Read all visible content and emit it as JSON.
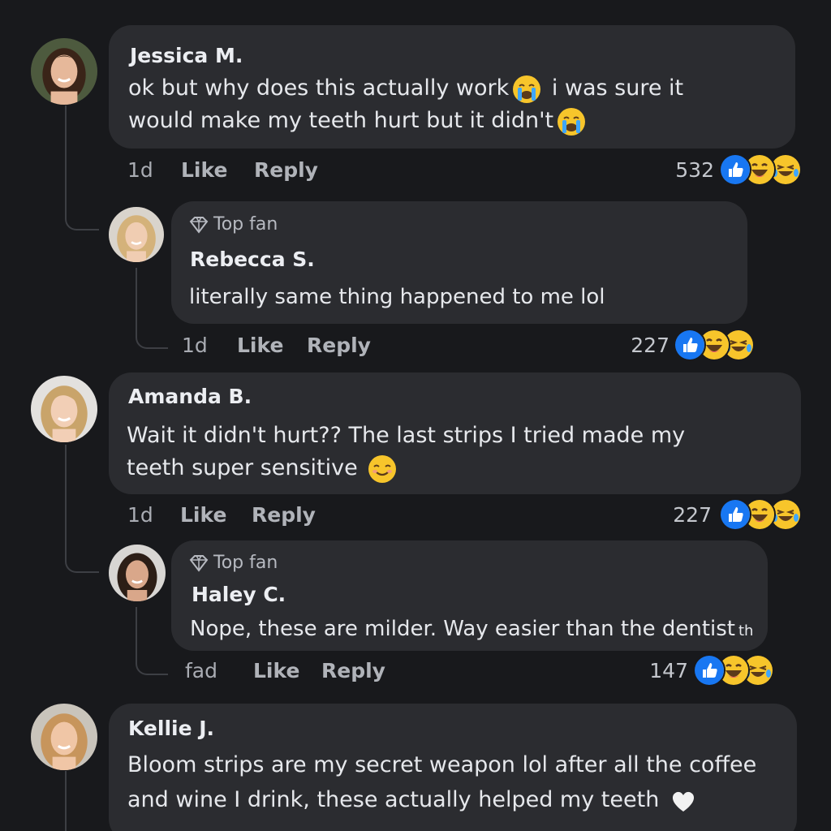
{
  "comments": [
    {
      "name": "Jessica M.",
      "line1": "ok but why does this actually work",
      "line1b": "i was sure it",
      "line2": "would make my teeth hurt but it didn't",
      "time": "1d",
      "like": "Like",
      "reply": "Reply",
      "count": "532",
      "reactions": [
        "like-icon",
        "laugh-icon",
        "laugh-tears-icon"
      ]
    },
    {
      "badge": "Top fan",
      "name": "Rebecca S.",
      "line1": "literally same thing happened to me lol",
      "time": "1d",
      "like": "Like",
      "reply": "Reply",
      "count": "227",
      "reactions": [
        "like-icon",
        "laugh-icon",
        "laugh-tears-icon"
      ]
    },
    {
      "name": "Amanda B.",
      "line1": "Wait it didn't hurt?? The last strips I tried made my",
      "line2": "teeth super sensitive",
      "time": "1d",
      "like": "Like",
      "reply": "Reply",
      "count": "227",
      "reactions": [
        "like-icon",
        "laugh-icon",
        "laugh-tears-icon"
      ]
    },
    {
      "badge": "Top fan",
      "name": "Haley C.",
      "line1": "Nope, these are milder. Way easier than the dentist",
      "line1tail": "th",
      "time": "fad",
      "like": "Like",
      "reply": "Reply",
      "count": "147",
      "reactions": [
        "like-icon",
        "laugh-icon",
        "laugh-tears-icon"
      ]
    },
    {
      "name": "Kellie J.",
      "line1": "Bloom strips are my secret weapon lol after all the coffee",
      "line2": "and wine I drink, these actually helped my teeth"
    }
  ],
  "colors": {
    "background": "#18191c",
    "bubble": "#2b2c30",
    "like_blue": "#1877f2",
    "emoji_yellow": "#f7c52b"
  }
}
